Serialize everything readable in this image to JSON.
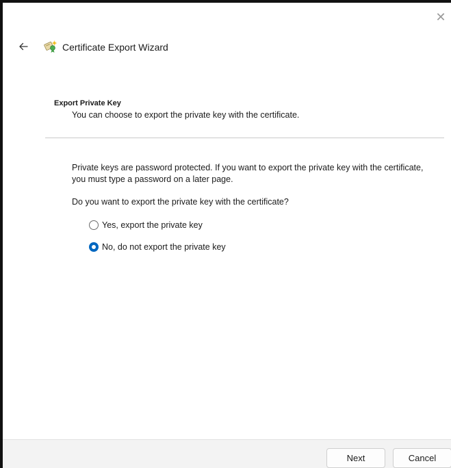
{
  "window": {
    "title": "Certificate Export Wizard",
    "close_glyph": "✕",
    "back_icon": "back-arrow-icon",
    "title_icon": "certificate-wizard-icon"
  },
  "section": {
    "heading": "Export Private Key",
    "subheading": "You can choose to export the private key with the certificate."
  },
  "content": {
    "description": "Private keys are password protected. If you want to export the private key with the certificate, you must type a password on a later page.",
    "question": "Do you want to export the private key with the certificate?"
  },
  "options": [
    {
      "label": "Yes, export the private key",
      "selected": false
    },
    {
      "label": "No, do not export the private key",
      "selected": true
    }
  ],
  "buttons": {
    "next": "Next",
    "cancel": "Cancel"
  },
  "colors": {
    "accent": "#0067c0",
    "footer": "#f3f3f3"
  }
}
